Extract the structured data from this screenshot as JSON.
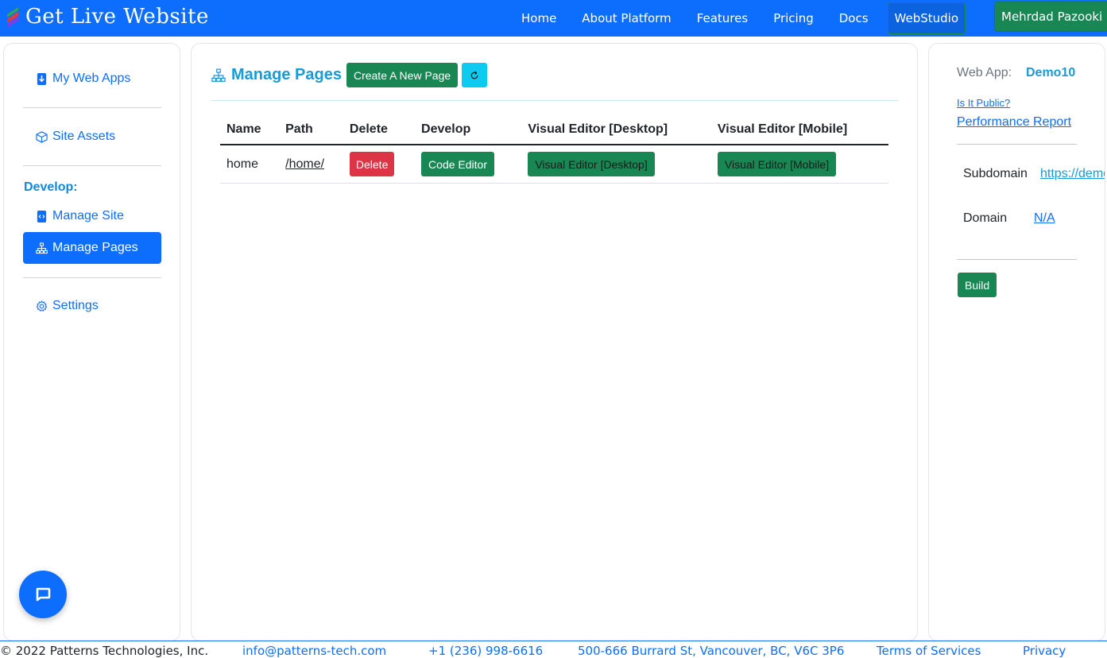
{
  "brand": {
    "name": "Get Live Website"
  },
  "nav": {
    "links": [
      "Home",
      "About Platform",
      "Features",
      "Pricing",
      "Docs"
    ],
    "studio": "WebStudio",
    "user": "Mehrdad Pazooki"
  },
  "sidebar": {
    "my_web_apps": "My Web Apps",
    "site_assets": "Site Assets",
    "develop_heading": "Develop:",
    "manage_site": "Manage Site",
    "manage_pages": "Manage Pages",
    "settings": "Settings"
  },
  "main": {
    "title": "Manage Pages",
    "create_button": "Create A New Page",
    "columns": [
      "Name",
      "Path",
      "Delete",
      "Develop",
      "Visual Editor [Desktop]",
      "Visual Editor [Mobile]"
    ],
    "rows": [
      {
        "name": "home",
        "path": "/home/",
        "delete": "Delete",
        "develop": "Code Editor",
        "desktop": "Visual Editor [Desktop]",
        "mobile": "Visual Editor [Mobile]"
      }
    ]
  },
  "details": {
    "web_app_label": "Web App:",
    "web_app_value": "Demo10",
    "is_public": "Is It Public?",
    "performance": "Performance Report",
    "subdomain_label": "Subdomain",
    "subdomain_value": "https://demo",
    "domain_label": "Domain",
    "domain_value": "N/A",
    "build": "Build"
  },
  "footer": {
    "copyright": "© 2022 Patterns Technologies, Inc.",
    "email": "info@patterns-tech.com",
    "phone": "+1 (236) 998-6616",
    "address": "500-666 Burrard St, Vancouver, BC, V6C 3P6",
    "terms": "Terms of Services",
    "privacy": "Privacy"
  },
  "colors": {
    "primary": "#0d6efd",
    "success": "#198754",
    "danger": "#dc3545",
    "info": "#0dcaf0",
    "accent_text": "#1a9ad6"
  }
}
